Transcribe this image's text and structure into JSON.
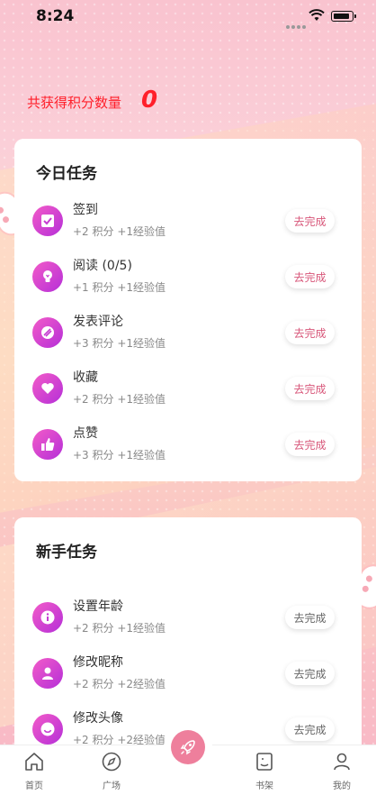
{
  "status_bar": {
    "time": "8:24"
  },
  "summary": {
    "label": "共获得积分数量",
    "value": "0"
  },
  "daily": {
    "title": "今日任务",
    "tasks": [
      {
        "name": "签到",
        "reward": "+2 积分 +1经验值",
        "button": "去完成",
        "icon": "checkbox-icon"
      },
      {
        "name": "阅读 (0/5)",
        "reward": "+1 积分 +1经验值",
        "button": "去完成",
        "icon": "lightbulb-icon"
      },
      {
        "name": "发表评论",
        "reward": "+3 积分 +1经验值",
        "button": "去完成",
        "icon": "comment-icon"
      },
      {
        "name": "收藏",
        "reward": "+2 积分 +1经验值",
        "button": "去完成",
        "icon": "heart-icon"
      },
      {
        "name": "点赞",
        "reward": "+3 积分 +1经验值",
        "button": "去完成",
        "icon": "thumbs-up-icon"
      }
    ]
  },
  "newbie": {
    "title": "新手任务",
    "tasks": [
      {
        "name": "设置年龄",
        "reward": "+2 积分 +1经验值",
        "button": "去完成",
        "icon": "info-icon"
      },
      {
        "name": "修改昵称",
        "reward": "+2 积分 +2经验值",
        "button": "去完成",
        "icon": "person-icon"
      },
      {
        "name": "修改头像",
        "reward": "+2 积分 +2经验值",
        "button": "去完成",
        "icon": "smile-icon"
      }
    ]
  },
  "tabbar": {
    "items": [
      {
        "label": "首页",
        "icon": "home-icon"
      },
      {
        "label": "广场",
        "icon": "compass-icon"
      },
      {
        "label": "书架",
        "icon": "bookshelf-icon"
      },
      {
        "label": "我的",
        "icon": "user-icon"
      }
    ],
    "center_icon": "rocket-icon"
  },
  "colors": {
    "accent": "#ff1f2a",
    "button_text": "#d8577a",
    "icon_gradient_start": "#f35bc8",
    "icon_gradient_end": "#b52fd8",
    "center_button": "#ee7f9c"
  }
}
